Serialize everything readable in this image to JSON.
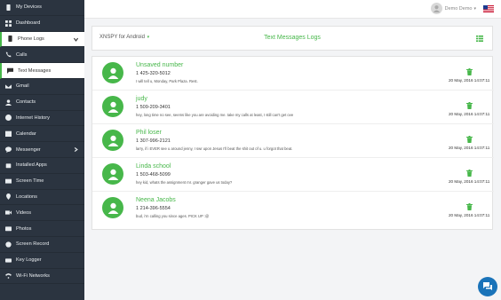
{
  "colors": {
    "accent": "#47b74a",
    "sidebar": "#2b3440",
    "chat": "#1a73b9"
  },
  "sidebar": {
    "items": [
      {
        "label": "My Devices",
        "icon": "phone-icon"
      },
      {
        "label": "Dashboard",
        "icon": "dashboard-icon"
      },
      {
        "label": "Phone Logs",
        "icon": "phone-icon"
      },
      {
        "label": "Calls",
        "icon": "call-icon"
      },
      {
        "label": "Text Messages",
        "icon": "message-icon"
      },
      {
        "label": "Gmail",
        "icon": "mail-icon"
      },
      {
        "label": "Contacts",
        "icon": "contacts-icon"
      },
      {
        "label": "Internet History",
        "icon": "globe-icon"
      },
      {
        "label": "Calendar",
        "icon": "calendar-icon"
      },
      {
        "label": "Messenger",
        "icon": "messenger-icon"
      },
      {
        "label": "Installed Apps",
        "icon": "apps-icon"
      },
      {
        "label": "Screen Time",
        "icon": "clock-icon"
      },
      {
        "label": "Locations",
        "icon": "location-icon"
      },
      {
        "label": "Videos",
        "icon": "video-icon"
      },
      {
        "label": "Photos",
        "icon": "camera-icon"
      },
      {
        "label": "Screen Record",
        "icon": "record-icon"
      },
      {
        "label": "Key Logger",
        "icon": "keyboard-icon"
      },
      {
        "label": "Wi-Fi Networks",
        "icon": "wifi-icon"
      }
    ]
  },
  "header": {
    "user_name": "Demo Demo",
    "user_caret": "▾"
  },
  "toolbar": {
    "device": "XNSPY for Android",
    "device_caret": "▾",
    "title": "Text Messages Logs"
  },
  "messages": [
    {
      "name": "Unsaved number",
      "phone": "1 425-320-5012",
      "text": "I will tell u, Monday, Park Plaza. Rest.",
      "date": "20 May, 2016 14:07:11"
    },
    {
      "name": "judy",
      "phone": "1 509-209-3401",
      "text": "hey, long time no see, seems like you are avoiding me. take my calls at least, I still can't get ove",
      "date": "20 May, 2016 14:07:11"
    },
    {
      "name": "Phil loser",
      "phone": "1 307-996-2121",
      "text": "larry, if i EVER see u around jenny, I swr upon Jesus I'll beat the shit out of u. u forgot that beat.",
      "date": "20 May, 2016 14:07:11"
    },
    {
      "name": "Linda school",
      "phone": "1 503-468-5099",
      "text": "hey kid, whats the assignment mr. granger gave us today?",
      "date": "20 May, 2016 14:07:11"
    },
    {
      "name": "Neena Jacobs",
      "phone": "1 214-396-5554",
      "text": "bud, i'm calling you since ages. PICK UP :@",
      "date": "20 May, 2016 14:07:11"
    }
  ]
}
